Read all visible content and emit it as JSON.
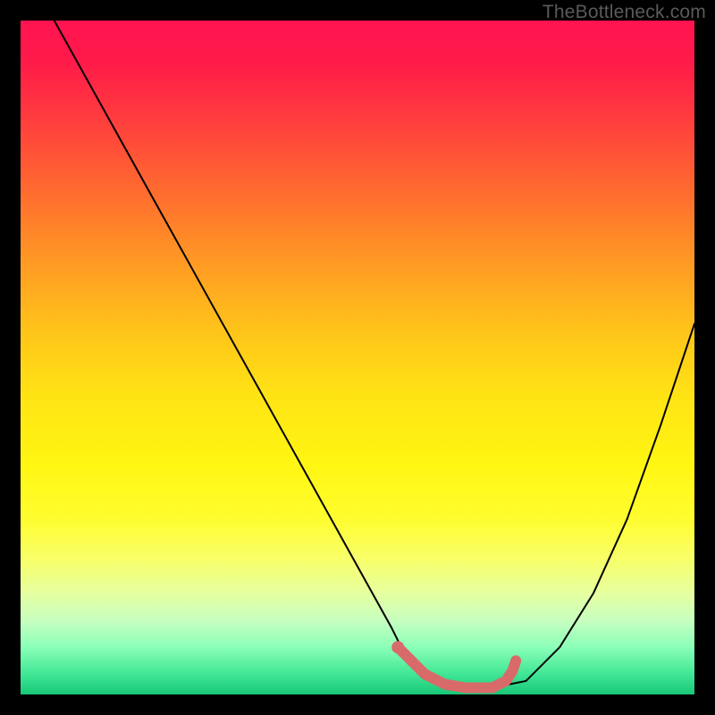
{
  "watermark": "TheBottleneck.com",
  "chart_data": {
    "type": "line",
    "title": "",
    "xlabel": "",
    "ylabel": "",
    "xlim": [
      0,
      100
    ],
    "ylim": [
      0,
      100
    ],
    "grid": false,
    "series": [
      {
        "name": "bottleneck-curve",
        "color": "#000000",
        "stroke_width": 2,
        "x": [
          5,
          10,
          15,
          20,
          25,
          30,
          35,
          40,
          45,
          50,
          55,
          57,
          60,
          63,
          66,
          70,
          75,
          80,
          85,
          90,
          95,
          100
        ],
        "y": [
          100,
          91,
          82,
          73,
          64,
          55,
          46,
          37,
          28,
          19,
          10,
          6,
          3,
          1.5,
          1,
          1,
          2,
          7,
          15,
          26,
          40,
          55
        ]
      },
      {
        "name": "optimal-range",
        "color": "#d86a6a",
        "stroke_width": 12,
        "x": [
          56,
          57,
          60,
          63,
          66,
          70,
          72,
          73,
          73.5
        ],
        "y": [
          7,
          6,
          3,
          1.5,
          1,
          1,
          2,
          3.5,
          5
        ]
      }
    ],
    "annotations": [
      {
        "type": "dot",
        "x": 56,
        "y": 7,
        "r": 7,
        "color": "#d86a6a"
      }
    ]
  }
}
